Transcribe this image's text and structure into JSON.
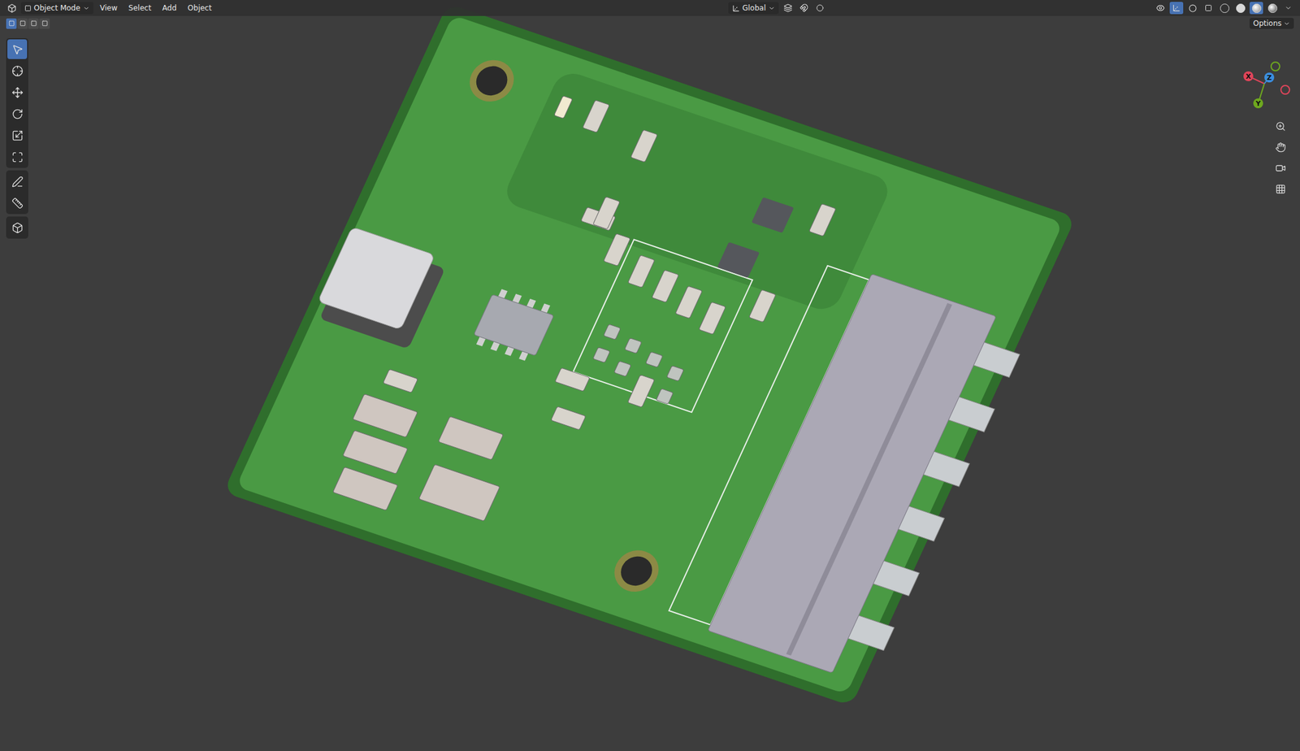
{
  "header": {
    "mode": "Object Mode",
    "menus": [
      "View",
      "Select",
      "Add",
      "Object"
    ],
    "orientation": "Global",
    "options": "Options"
  },
  "select_modes": [
    {
      "selected": true
    },
    {
      "selected": false
    },
    {
      "selected": false
    },
    {
      "selected": false
    }
  ],
  "toolbar": [
    {
      "kind": "select",
      "selected": true
    },
    {
      "kind": "cursor",
      "selected": false
    },
    {
      "kind": "move",
      "selected": false
    },
    {
      "kind": "rotate",
      "selected": false
    },
    {
      "kind": "scale",
      "selected": false
    },
    {
      "kind": "transform",
      "selected": false
    },
    {
      "kind": "annotate",
      "selected": false
    },
    {
      "kind": "measure",
      "selected": false
    },
    {
      "kind": "add-cube",
      "selected": false
    }
  ],
  "shading": [
    {
      "kind": "wireframe",
      "selected": false
    },
    {
      "kind": "solid",
      "selected": false
    },
    {
      "kind": "material",
      "selected": true
    },
    {
      "kind": "rendered",
      "selected": false
    }
  ],
  "gizmo": [
    {
      "label": "X",
      "color": "#e0455a"
    },
    {
      "label": "Y",
      "color": "#6ea81f"
    },
    {
      "label": "Z",
      "color": "#3b8fe0"
    }
  ],
  "navigation": [
    {
      "kind": "zoom"
    },
    {
      "kind": "pan"
    },
    {
      "kind": "camera"
    },
    {
      "kind": "ortho"
    }
  ]
}
